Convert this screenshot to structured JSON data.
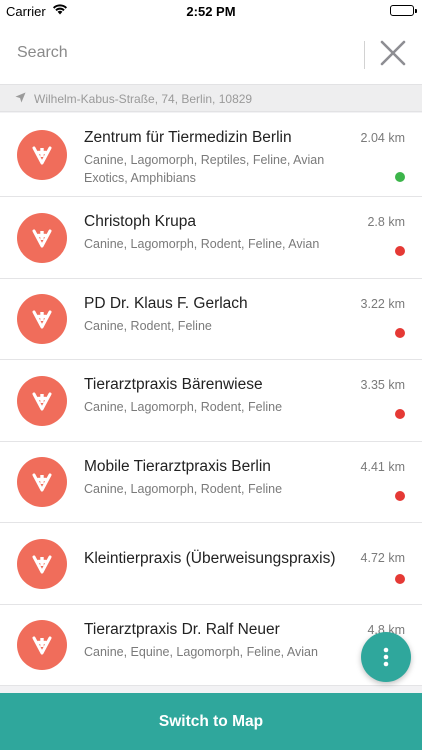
{
  "status_bar": {
    "carrier": "Carrier",
    "time": "2:52 PM",
    "battery_level": 1.0
  },
  "search": {
    "placeholder": "Search",
    "value": "",
    "close_icon": "close-icon"
  },
  "location": {
    "icon": "location-arrow-icon",
    "address": "Wilhelm-Kabus-Straße, 74, Berlin, 10829"
  },
  "colors": {
    "accent": "#2fa79c",
    "avatar": "#f06d5b",
    "open": "#3cb54a",
    "closed": "#e53935"
  },
  "vets": [
    {
      "name": "Zentrum für Tiermedizin Berlin",
      "distance": "2.04 km",
      "species_line1": [
        "Canine",
        "Lagomorph",
        "Reptiles",
        "Feline",
        "Avian"
      ],
      "species_line2": [
        "Exotics",
        "Amphibians"
      ],
      "status": "open"
    },
    {
      "name": "Christoph Krupa",
      "distance": "2.8 km",
      "species_line1": [
        "Canine",
        "Lagomorph",
        "Rodent",
        "Feline",
        "Avian"
      ],
      "species_line2": [],
      "status": "closed"
    },
    {
      "name": "PD Dr. Klaus F. Gerlach",
      "distance": "3.22 km",
      "species_line1": [
        "Canine",
        "Rodent",
        "Feline"
      ],
      "species_line2": [],
      "status": "closed"
    },
    {
      "name": "Tierarztpraxis Bärenwiese",
      "distance": "3.35 km",
      "species_line1": [
        "Canine",
        "Lagomorph",
        "Rodent",
        "Feline"
      ],
      "species_line2": [],
      "status": "closed"
    },
    {
      "name": "Mobile Tierarztpraxis Berlin",
      "distance": "4.41 km",
      "species_line1": [
        "Canine",
        "Lagomorph",
        "Rodent",
        "Feline"
      ],
      "species_line2": [],
      "status": "closed"
    },
    {
      "name": "Kleintierpraxis (Überweisungspraxis)",
      "distance": "4.72 km",
      "species_line1": [],
      "species_line2": [],
      "status": "closed"
    },
    {
      "name": "Tierarztpraxis Dr. Ralf Neuer",
      "distance": "4.8 km",
      "species_line1": [
        "Canine",
        "Equine",
        "Lagomorph",
        "Feline",
        "Avian"
      ],
      "species_line2": [],
      "status": "closed"
    }
  ],
  "fab": {
    "icon": "more-vertical-icon"
  },
  "footer": {
    "switch_label": "Switch to Map"
  }
}
